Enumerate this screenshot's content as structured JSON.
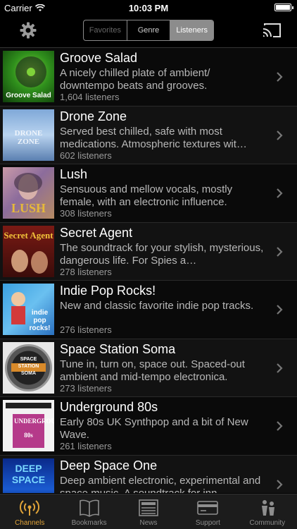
{
  "status_bar": {
    "carrier": "Carrier",
    "time": "10:03 PM"
  },
  "nav": {
    "segments": [
      "Favorites",
      "Genre",
      "Listeners"
    ],
    "selected_segment": "Listeners"
  },
  "channels": [
    {
      "title": "Groove Salad",
      "desc": "A nicely chilled plate of ambient/ downtempo beats and grooves.",
      "listeners": "1,604 listeners",
      "art_caption": "Groove Salad"
    },
    {
      "title": "Drone Zone",
      "desc": "Served best chilled, safe with most medications. Atmospheric textures wit…",
      "listeners": "602 listeners",
      "art_caption": "DRONE ZONE"
    },
    {
      "title": "Lush",
      "desc": "Sensuous and mellow vocals, mostly female, with an electronic influence.",
      "listeners": "308 listeners",
      "art_caption": "LUSH"
    },
    {
      "title": "Secret Agent",
      "desc": "The soundtrack for your stylish, mysterious, dangerous life. For Spies a…",
      "listeners": "278 listeners",
      "art_caption": "Secret Agent"
    },
    {
      "title": "Indie Pop Rocks!",
      "desc": "New and classic favorite indie pop tracks.",
      "listeners": "276 listeners",
      "art_caption": "indie pop rocks!"
    },
    {
      "title": "Space Station Soma",
      "desc": "Tune in, turn on, space out. Spaced-out ambient and mid-tempo electronica.",
      "listeners": "273 listeners",
      "art_caption": "SPACE STATION SOMA"
    },
    {
      "title": "Underground 80s",
      "desc": "Early 80s UK Synthpop and a bit of New Wave.",
      "listeners": "261 listeners",
      "art_caption": "UNDERGROUND 80s"
    },
    {
      "title": "Deep Space One",
      "desc": "Deep ambient electronic, experimental and space music. A soundtrack for inn…",
      "listeners": "",
      "art_caption": "DEEP SPACE"
    }
  ],
  "tabs": [
    {
      "label": "Channels",
      "icon": "broadcast-icon",
      "active": true
    },
    {
      "label": "Bookmarks",
      "icon": "book-icon",
      "active": false
    },
    {
      "label": "News",
      "icon": "newspaper-icon",
      "active": false
    },
    {
      "label": "Support",
      "icon": "credit-card-icon",
      "active": false
    },
    {
      "label": "Community",
      "icon": "people-icon",
      "active": false
    }
  ],
  "colors": {
    "accent": "#e0a338",
    "background": "#000000"
  }
}
